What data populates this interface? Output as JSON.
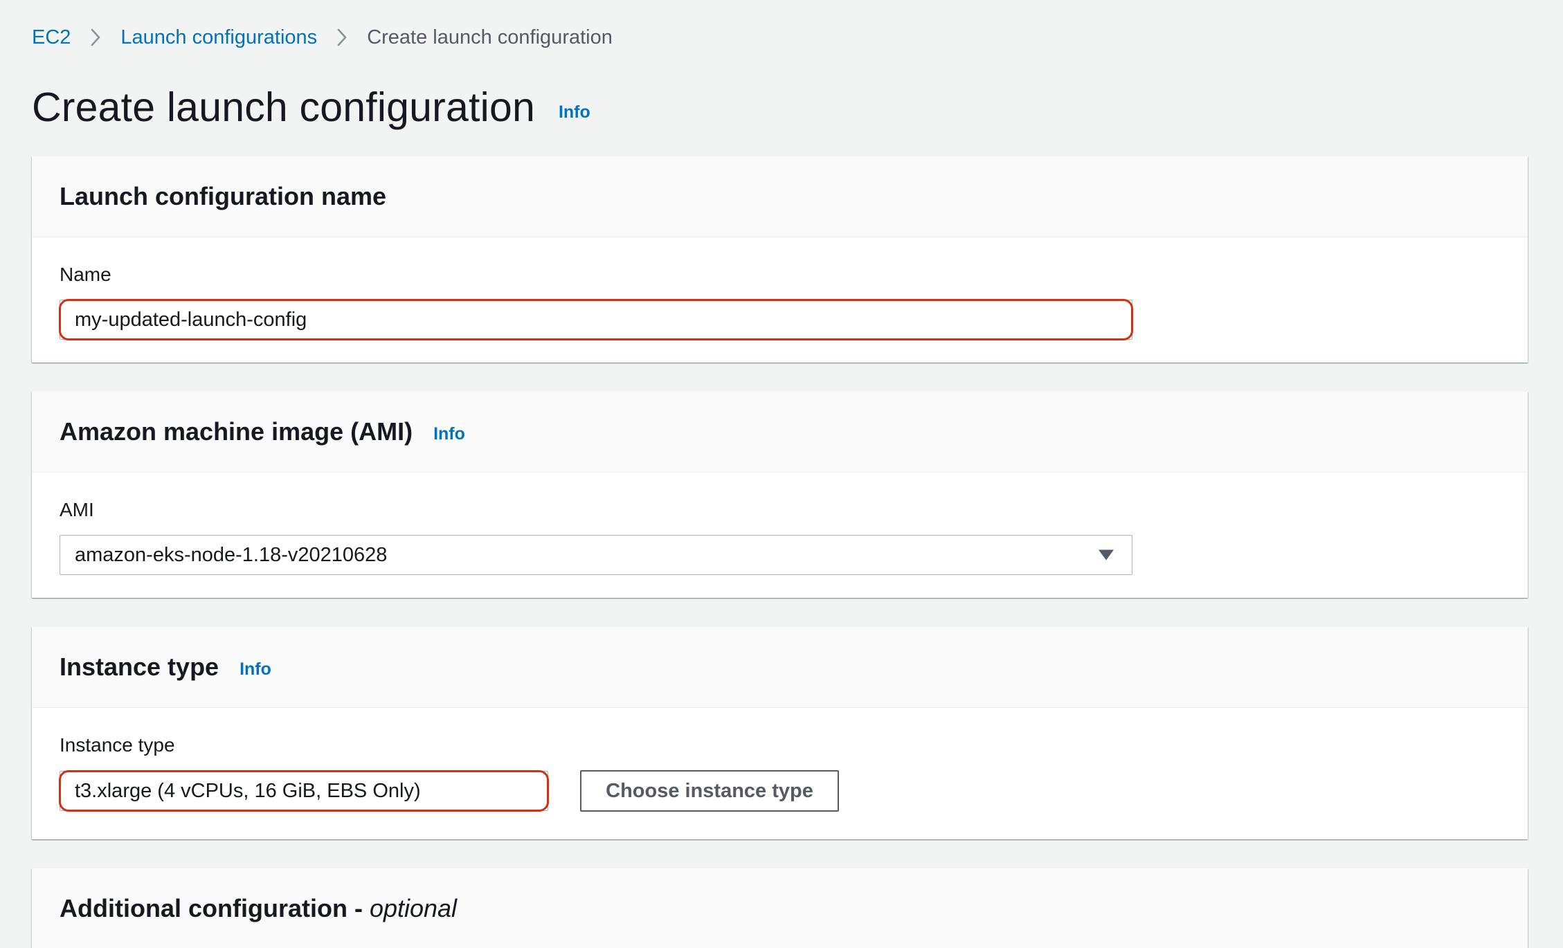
{
  "breadcrumb": {
    "items": [
      "EC2",
      "Launch configurations",
      "Create launch configuration"
    ]
  },
  "header": {
    "title": "Create launch configuration",
    "info": "Info"
  },
  "sections": {
    "name": {
      "title": "Launch configuration name",
      "field_label": "Name",
      "value": "my-updated-launch-config"
    },
    "ami": {
      "title": "Amazon machine image (AMI)",
      "info": "Info",
      "field_label": "AMI",
      "selected": "amazon-eks-node-1.18-v20210628"
    },
    "instance_type": {
      "title": "Instance type",
      "info": "Info",
      "field_label": "Instance type",
      "value": "t3.xlarge (4 vCPUs, 16 GiB, EBS Only)",
      "choose_button": "Choose instance type"
    },
    "additional": {
      "title": "Additional configuration - ",
      "title_suffix": "optional"
    }
  },
  "colors": {
    "link": "#0073bb",
    "highlight": "#d13212",
    "background": "#f2f3f3"
  }
}
